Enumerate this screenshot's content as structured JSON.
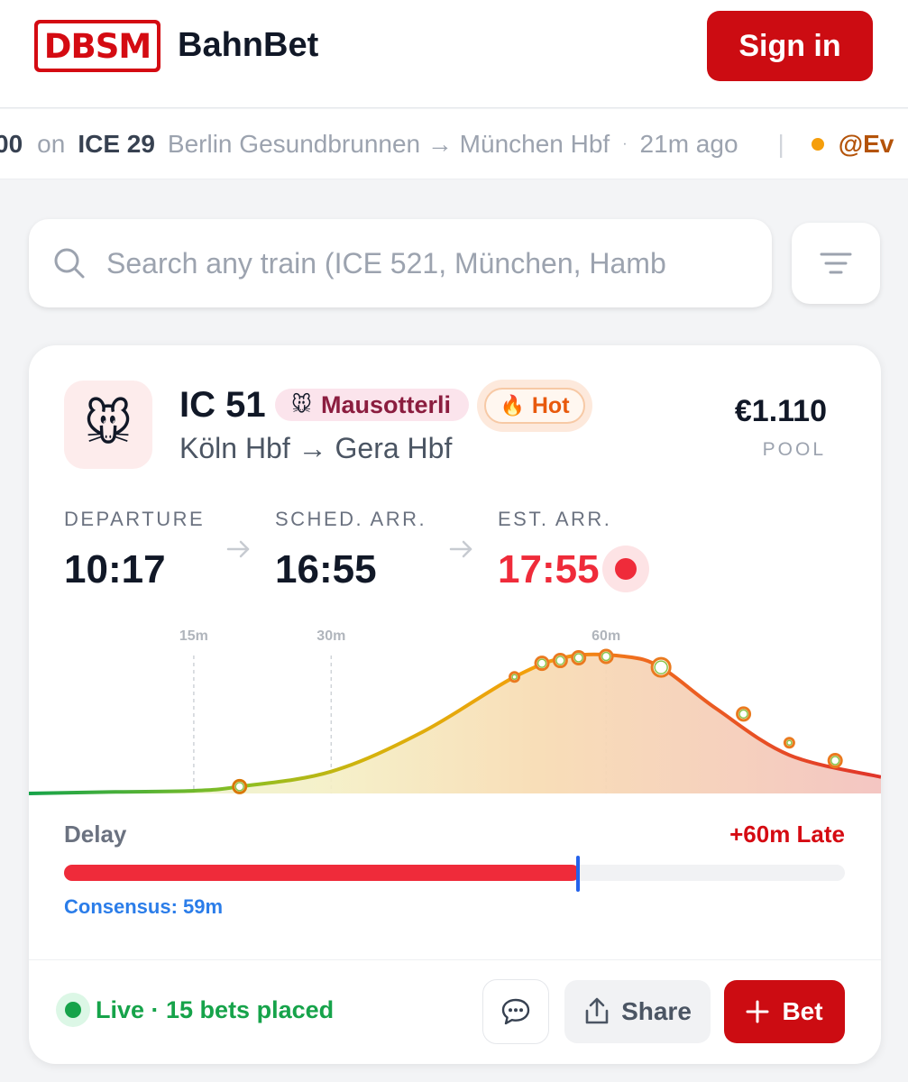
{
  "header": {
    "logo_text": "DBSM",
    "brand": "BahnBet",
    "signin_label": "Sign in"
  },
  "ticker": {
    "amount_fragment": "00",
    "on_word": "on",
    "train": "ICE 29",
    "route": "Berlin Gesundbrunnen → München Hbf",
    "separator": "·",
    "ago": "21m ago",
    "divider": "|",
    "next_user_fragment": "@Ev"
  },
  "search": {
    "placeholder": "Search any train (ICE 521, München, Hamb",
    "value": ""
  },
  "card": {
    "avatar_emoji": "🐭",
    "train": "IC 51",
    "tag_user_emoji": "🐭",
    "tag_user": "Mausotterli",
    "tag_hot_emoji": "🔥",
    "tag_hot": "Hot",
    "route": "Köln Hbf → Gera Hbf",
    "pool_amount": "€1.110",
    "pool_label": "POOL",
    "times": {
      "departure_label": "DEPARTURE",
      "departure": "10:17",
      "sched_label": "SCHED. ARR.",
      "sched": "16:55",
      "est_label": "EST. ARR.",
      "est": "17:55"
    },
    "delay": {
      "label": "Delay",
      "value": "+60m Late",
      "fill_fraction": 0.66,
      "consensus_fraction": 0.658,
      "consensus_label": "Consensus: 59m"
    },
    "live_text": "Live · 15 bets placed",
    "share_label": "Share",
    "bet_label": "Bet",
    "colors": {
      "brand_red": "#cc0c12",
      "late_red": "#ef2b3a",
      "consensus_blue": "#2563eb",
      "live_green": "#16a34a"
    }
  },
  "chart_data": {
    "type": "area",
    "xlabel": "",
    "ylabel": "",
    "x_range": [
      -3,
      90
    ],
    "ticks": [
      {
        "value": 15,
        "label": "15m"
      },
      {
        "value": 30,
        "label": "30m"
      },
      {
        "value": 60,
        "label": "60m"
      }
    ],
    "curve": {
      "x": [
        -3,
        5,
        15,
        20,
        30,
        40,
        50,
        56,
        62,
        66,
        72,
        80,
        90
      ],
      "y": [
        0,
        0.01,
        0.02,
        0.05,
        0.16,
        0.45,
        0.85,
        1.0,
        1.0,
        0.92,
        0.62,
        0.28,
        0.12
      ]
    },
    "bets": [
      {
        "x": 20,
        "y": 0.05
      },
      {
        "x": 50,
        "y": 0.85
      },
      {
        "x": 53,
        "y": 0.95
      },
      {
        "x": 55,
        "y": 0.97
      },
      {
        "x": 57,
        "y": 0.99
      },
      {
        "x": 60,
        "y": 1.0
      },
      {
        "x": 66,
        "y": 0.92
      },
      {
        "x": 75,
        "y": 0.58
      },
      {
        "x": 80,
        "y": 0.37
      },
      {
        "x": 85,
        "y": 0.24
      }
    ],
    "highlight_x": 66
  }
}
